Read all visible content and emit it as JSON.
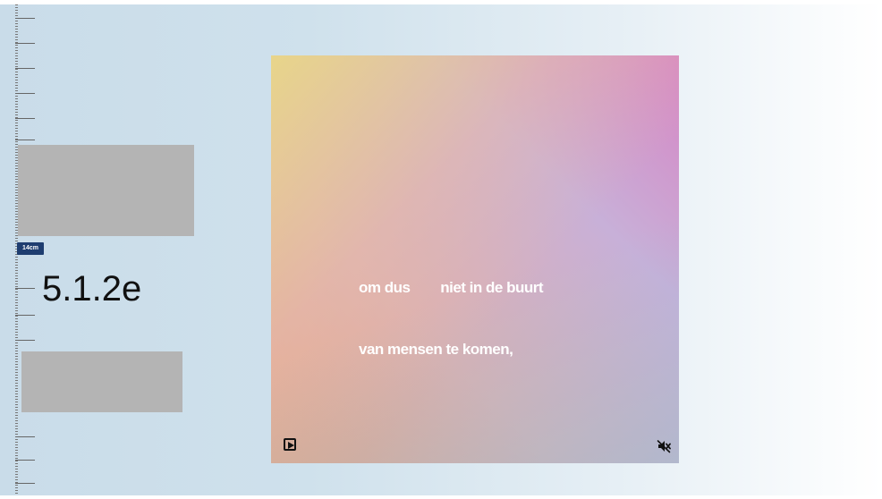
{
  "sidebar": {
    "zoom_badge": "14cm",
    "section_number": "5.1.2e"
  },
  "video": {
    "caption_line1": "om dus        niet in de buurt",
    "caption_line2": "van mensen te komen,",
    "controls": {
      "play_icon": "play-icon",
      "mute_icon": "volume-muted-icon"
    }
  },
  "colors": {
    "page_background": "#cfe1ec",
    "badge_background": "#1e3d70",
    "gray_block": "#b4b4b4",
    "caption_text": "#ffffff"
  }
}
